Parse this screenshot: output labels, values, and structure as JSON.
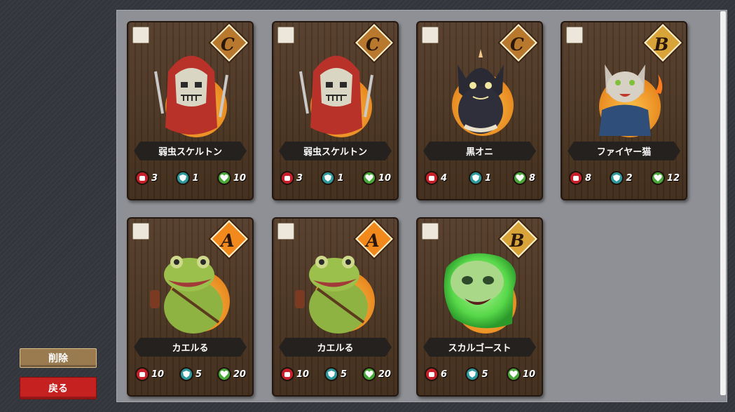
{
  "sidebar": {
    "delete_label": "削除",
    "back_label": "戻る"
  },
  "colors": {
    "delete_button": "#9a7a4f",
    "back_button": "#c62121",
    "panel": "#8e9095",
    "card_wood": "#4b3626",
    "attack": "#c8202a",
    "defense": "#2f9a9e",
    "health": "#4aa83a"
  },
  "cards": [
    {
      "name": "弱虫スケルトン",
      "rank": "C",
      "attack": "3",
      "defense": "1",
      "health": "10",
      "icon": "red-hooded-skeleton-portrait"
    },
    {
      "name": "弱虫スケルトン",
      "rank": "C",
      "attack": "3",
      "defense": "1",
      "health": "10",
      "icon": "red-hooded-skeleton-portrait"
    },
    {
      "name": "黒オニ",
      "rank": "C",
      "attack": "4",
      "defense": "1",
      "health": "8",
      "icon": "black-oni-portrait"
    },
    {
      "name": "ファイヤー猫",
      "rank": "B",
      "attack": "8",
      "defense": "2",
      "health": "12",
      "icon": "fire-cat-portrait"
    },
    {
      "name": "カエルる",
      "rank": "A",
      "attack": "10",
      "defense": "5",
      "health": "20",
      "icon": "frog-warrior-portrait"
    },
    {
      "name": "カエルる",
      "rank": "A",
      "attack": "10",
      "defense": "5",
      "health": "20",
      "icon": "frog-warrior-portrait"
    },
    {
      "name": "スカルゴースト",
      "rank": "B",
      "attack": "6",
      "defense": "5",
      "health": "10",
      "icon": "green-skull-ghost-portrait"
    }
  ]
}
